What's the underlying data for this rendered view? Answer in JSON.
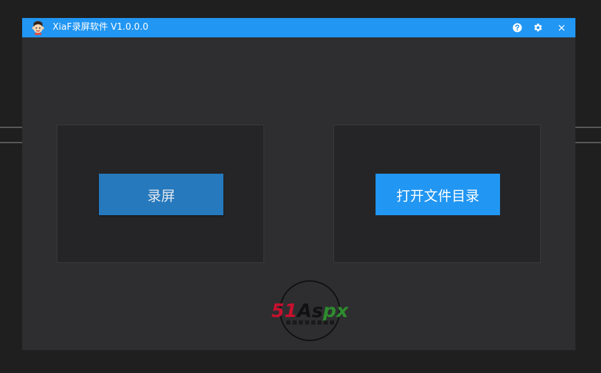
{
  "window": {
    "title": "XiaF录屏软件 V1.0.0.0"
  },
  "titlebar": {
    "help_icon": "help-circle-icon",
    "settings_icon": "gear-icon",
    "close_icon": "close-icon",
    "close_glyph": "×"
  },
  "main": {
    "record_button": {
      "label": "录屏"
    },
    "open_folder_button": {
      "label": "打开文件目录"
    }
  },
  "watermark": {
    "brand": "51Aspx"
  },
  "colors": {
    "titlebar": "#2196f3",
    "window_bg": "#2e2e30",
    "panel_bg": "#252527",
    "record_button": "#2779bd",
    "open_button": "#2196f3",
    "logo_red": "#c8102e",
    "logo_green": "#2e8b2e"
  }
}
